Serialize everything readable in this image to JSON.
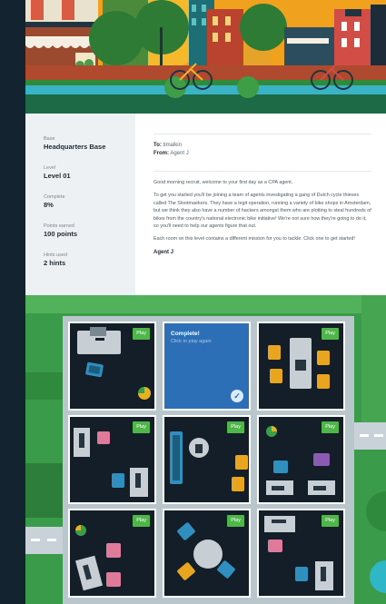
{
  "sidebar": {
    "base_label": "Base",
    "base_value": "Headquarters Base",
    "level_label": "Level",
    "level_value": "Level 01",
    "complete_label": "Complete",
    "complete_value": "8%",
    "points_label": "Points earned",
    "points_value": "100 points",
    "hints_label": "Hints used",
    "hints_value": "2 hints"
  },
  "message": {
    "to_label": "To:",
    "to_value": "timalkin",
    "from_label": "From:",
    "from_value": "Agent J",
    "p1": "Good morning recruit, welcome to your first day as a CPA agent.",
    "p2": "To get you started you'll be joining a team of agents investigating a gang of Dutch cycle thieves called The Slootmaekers. They have a legit operation, running a variety of bike shops in Amsterdam, but we think they also have a number of hackers amongst them who are plotting to steal hundreds of bikes from the country's national electronic bike initiative! We're not sure how they're going to do it, so you'll need to help our agents figure that out.",
    "p3": "Each room on this level contains a different mission for you to tackle. Click one to get started!",
    "signature": "Agent J"
  },
  "rooms": {
    "play_label": "Play",
    "complete_title": "Complete!",
    "complete_sub": "Click to play again",
    "check_glyph": "✓"
  },
  "colors": {
    "rail": "#13232f",
    "sidebar_bg": "#eef1f3",
    "play_green": "#4fb64a",
    "complete_blue": "#2d6fb6",
    "room_bg": "#141e29",
    "grass": "#3a9c4a"
  }
}
